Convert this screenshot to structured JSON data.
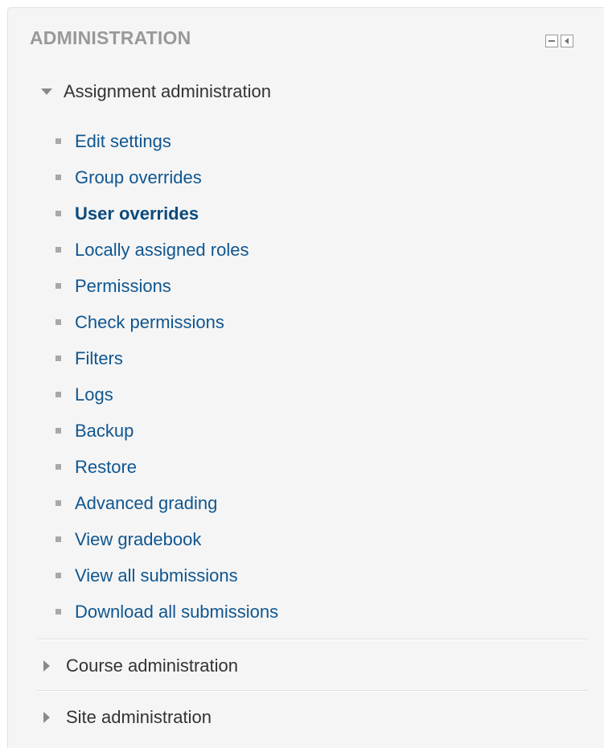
{
  "block": {
    "title": "ADMINISTRATION",
    "controls": [
      {
        "name": "hide",
        "icon": "minus-icon"
      },
      {
        "name": "dock",
        "icon": "dock-left-icon"
      }
    ]
  },
  "tree": {
    "assignment": {
      "label": "Assignment administration",
      "expanded": true,
      "items": [
        {
          "label": "Edit settings",
          "active": false
        },
        {
          "label": "Group overrides",
          "active": false
        },
        {
          "label": "User overrides",
          "active": true
        },
        {
          "label": "Locally assigned roles",
          "active": false
        },
        {
          "label": "Permissions",
          "active": false
        },
        {
          "label": "Check permissions",
          "active": false
        },
        {
          "label": "Filters",
          "active": false
        },
        {
          "label": "Logs",
          "active": false
        },
        {
          "label": "Backup",
          "active": false
        },
        {
          "label": "Restore",
          "active": false
        },
        {
          "label": "Advanced grading",
          "active": false
        },
        {
          "label": "View gradebook",
          "active": false
        },
        {
          "label": "View all submissions",
          "active": false
        },
        {
          "label": "Download all submissions",
          "active": false
        }
      ]
    },
    "course": {
      "label": "Course administration",
      "expanded": false
    },
    "site": {
      "label": "Site administration",
      "expanded": false
    }
  },
  "colors": {
    "link": "#0f5690",
    "title": "#999999",
    "background": "#f5f5f5"
  }
}
